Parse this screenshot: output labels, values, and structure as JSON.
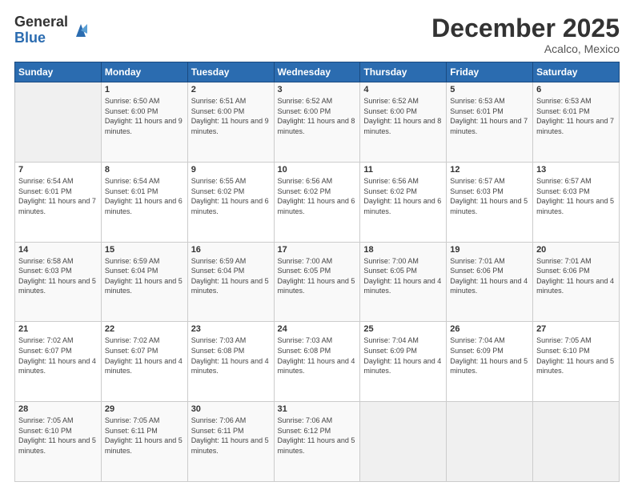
{
  "logo": {
    "general": "General",
    "blue": "Blue"
  },
  "title": "December 2025",
  "subtitle": "Acalco, Mexico",
  "days_header": [
    "Sunday",
    "Monday",
    "Tuesday",
    "Wednesday",
    "Thursday",
    "Friday",
    "Saturday"
  ],
  "weeks": [
    [
      {
        "day": "",
        "sunrise": "",
        "sunset": "",
        "daylight": ""
      },
      {
        "day": "1",
        "sunrise": "Sunrise: 6:50 AM",
        "sunset": "Sunset: 6:00 PM",
        "daylight": "Daylight: 11 hours and 9 minutes."
      },
      {
        "day": "2",
        "sunrise": "Sunrise: 6:51 AM",
        "sunset": "Sunset: 6:00 PM",
        "daylight": "Daylight: 11 hours and 9 minutes."
      },
      {
        "day": "3",
        "sunrise": "Sunrise: 6:52 AM",
        "sunset": "Sunset: 6:00 PM",
        "daylight": "Daylight: 11 hours and 8 minutes."
      },
      {
        "day": "4",
        "sunrise": "Sunrise: 6:52 AM",
        "sunset": "Sunset: 6:00 PM",
        "daylight": "Daylight: 11 hours and 8 minutes."
      },
      {
        "day": "5",
        "sunrise": "Sunrise: 6:53 AM",
        "sunset": "Sunset: 6:01 PM",
        "daylight": "Daylight: 11 hours and 7 minutes."
      },
      {
        "day": "6",
        "sunrise": "Sunrise: 6:53 AM",
        "sunset": "Sunset: 6:01 PM",
        "daylight": "Daylight: 11 hours and 7 minutes."
      }
    ],
    [
      {
        "day": "7",
        "sunrise": "Sunrise: 6:54 AM",
        "sunset": "Sunset: 6:01 PM",
        "daylight": "Daylight: 11 hours and 7 minutes."
      },
      {
        "day": "8",
        "sunrise": "Sunrise: 6:54 AM",
        "sunset": "Sunset: 6:01 PM",
        "daylight": "Daylight: 11 hours and 6 minutes."
      },
      {
        "day": "9",
        "sunrise": "Sunrise: 6:55 AM",
        "sunset": "Sunset: 6:02 PM",
        "daylight": "Daylight: 11 hours and 6 minutes."
      },
      {
        "day": "10",
        "sunrise": "Sunrise: 6:56 AM",
        "sunset": "Sunset: 6:02 PM",
        "daylight": "Daylight: 11 hours and 6 minutes."
      },
      {
        "day": "11",
        "sunrise": "Sunrise: 6:56 AM",
        "sunset": "Sunset: 6:02 PM",
        "daylight": "Daylight: 11 hours and 6 minutes."
      },
      {
        "day": "12",
        "sunrise": "Sunrise: 6:57 AM",
        "sunset": "Sunset: 6:03 PM",
        "daylight": "Daylight: 11 hours and 5 minutes."
      },
      {
        "day": "13",
        "sunrise": "Sunrise: 6:57 AM",
        "sunset": "Sunset: 6:03 PM",
        "daylight": "Daylight: 11 hours and 5 minutes."
      }
    ],
    [
      {
        "day": "14",
        "sunrise": "Sunrise: 6:58 AM",
        "sunset": "Sunset: 6:03 PM",
        "daylight": "Daylight: 11 hours and 5 minutes."
      },
      {
        "day": "15",
        "sunrise": "Sunrise: 6:59 AM",
        "sunset": "Sunset: 6:04 PM",
        "daylight": "Daylight: 11 hours and 5 minutes."
      },
      {
        "day": "16",
        "sunrise": "Sunrise: 6:59 AM",
        "sunset": "Sunset: 6:04 PM",
        "daylight": "Daylight: 11 hours and 5 minutes."
      },
      {
        "day": "17",
        "sunrise": "Sunrise: 7:00 AM",
        "sunset": "Sunset: 6:05 PM",
        "daylight": "Daylight: 11 hours and 5 minutes."
      },
      {
        "day": "18",
        "sunrise": "Sunrise: 7:00 AM",
        "sunset": "Sunset: 6:05 PM",
        "daylight": "Daylight: 11 hours and 4 minutes."
      },
      {
        "day": "19",
        "sunrise": "Sunrise: 7:01 AM",
        "sunset": "Sunset: 6:06 PM",
        "daylight": "Daylight: 11 hours and 4 minutes."
      },
      {
        "day": "20",
        "sunrise": "Sunrise: 7:01 AM",
        "sunset": "Sunset: 6:06 PM",
        "daylight": "Daylight: 11 hours and 4 minutes."
      }
    ],
    [
      {
        "day": "21",
        "sunrise": "Sunrise: 7:02 AM",
        "sunset": "Sunset: 6:07 PM",
        "daylight": "Daylight: 11 hours and 4 minutes."
      },
      {
        "day": "22",
        "sunrise": "Sunrise: 7:02 AM",
        "sunset": "Sunset: 6:07 PM",
        "daylight": "Daylight: 11 hours and 4 minutes."
      },
      {
        "day": "23",
        "sunrise": "Sunrise: 7:03 AM",
        "sunset": "Sunset: 6:08 PM",
        "daylight": "Daylight: 11 hours and 4 minutes."
      },
      {
        "day": "24",
        "sunrise": "Sunrise: 7:03 AM",
        "sunset": "Sunset: 6:08 PM",
        "daylight": "Daylight: 11 hours and 4 minutes."
      },
      {
        "day": "25",
        "sunrise": "Sunrise: 7:04 AM",
        "sunset": "Sunset: 6:09 PM",
        "daylight": "Daylight: 11 hours and 4 minutes."
      },
      {
        "day": "26",
        "sunrise": "Sunrise: 7:04 AM",
        "sunset": "Sunset: 6:09 PM",
        "daylight": "Daylight: 11 hours and 5 minutes."
      },
      {
        "day": "27",
        "sunrise": "Sunrise: 7:05 AM",
        "sunset": "Sunset: 6:10 PM",
        "daylight": "Daylight: 11 hours and 5 minutes."
      }
    ],
    [
      {
        "day": "28",
        "sunrise": "Sunrise: 7:05 AM",
        "sunset": "Sunset: 6:10 PM",
        "daylight": "Daylight: 11 hours and 5 minutes."
      },
      {
        "day": "29",
        "sunrise": "Sunrise: 7:05 AM",
        "sunset": "Sunset: 6:11 PM",
        "daylight": "Daylight: 11 hours and 5 minutes."
      },
      {
        "day": "30",
        "sunrise": "Sunrise: 7:06 AM",
        "sunset": "Sunset: 6:11 PM",
        "daylight": "Daylight: 11 hours and 5 minutes."
      },
      {
        "day": "31",
        "sunrise": "Sunrise: 7:06 AM",
        "sunset": "Sunset: 6:12 PM",
        "daylight": "Daylight: 11 hours and 5 minutes."
      },
      {
        "day": "",
        "sunrise": "",
        "sunset": "",
        "daylight": ""
      },
      {
        "day": "",
        "sunrise": "",
        "sunset": "",
        "daylight": ""
      },
      {
        "day": "",
        "sunrise": "",
        "sunset": "",
        "daylight": ""
      }
    ]
  ]
}
